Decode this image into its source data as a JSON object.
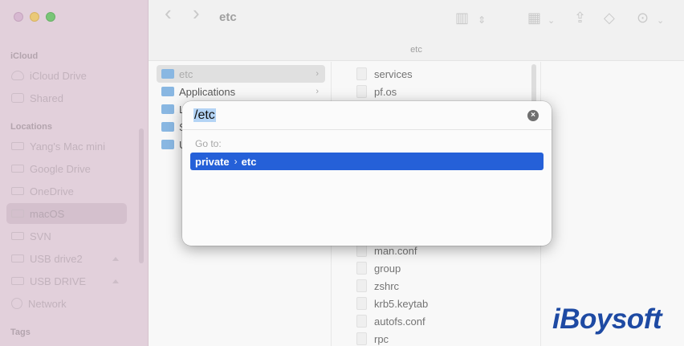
{
  "window": {
    "title": "etc",
    "path_bar": "etc"
  },
  "sidebar": {
    "sections": [
      {
        "label": "iCloud"
      },
      {
        "label": "Locations"
      },
      {
        "label": "Tags"
      }
    ],
    "icloud_items": [
      {
        "label": "iCloud Drive",
        "icon": "cloud-icon"
      },
      {
        "label": "Shared",
        "icon": "shared-folder-icon"
      }
    ],
    "location_items": [
      {
        "label": "Yang's Mac mini",
        "icon": "computer-icon"
      },
      {
        "label": "Google Drive",
        "icon": "disk-icon"
      },
      {
        "label": "OneDrive",
        "icon": "disk-icon"
      },
      {
        "label": "macOS",
        "icon": "disk-icon",
        "selected": true
      },
      {
        "label": "SVN",
        "icon": "disk-icon"
      },
      {
        "label": "USB drive2",
        "icon": "disk-icon",
        "ejectable": true
      },
      {
        "label": "USB DRIVE",
        "icon": "disk-icon",
        "ejectable": true
      },
      {
        "label": "Network",
        "icon": "globe-icon"
      }
    ]
  },
  "toolbar": {
    "back": "‹",
    "forward": "›",
    "view_toggle": "▥",
    "grid": "▦",
    "share": "⇪",
    "tag": "◇",
    "more": "⊙"
  },
  "column1": {
    "items": [
      {
        "label": "etc",
        "selected": true
      },
      {
        "label": "Applications"
      },
      {
        "label": "L"
      },
      {
        "label": "S"
      },
      {
        "label": "U"
      }
    ]
  },
  "column2": {
    "items": [
      {
        "label": "services"
      },
      {
        "label": "pf.os"
      },
      {
        "label": "man.conf"
      },
      {
        "label": "group"
      },
      {
        "label": "zshrc"
      },
      {
        "label": "krb5.keytab"
      },
      {
        "label": "autofs.conf"
      },
      {
        "label": "rpc"
      }
    ]
  },
  "dialog": {
    "input_value": "/etc",
    "clear_icon": "×",
    "goto_label": "Go to:",
    "result": {
      "part1": "private",
      "separator": "›",
      "part2": "etc"
    }
  },
  "watermark": "iBoysoft",
  "colors": {
    "accent": "#2560d8",
    "sidebar_bg": "#dcc6d4",
    "watermark": "#1e4aa3"
  }
}
